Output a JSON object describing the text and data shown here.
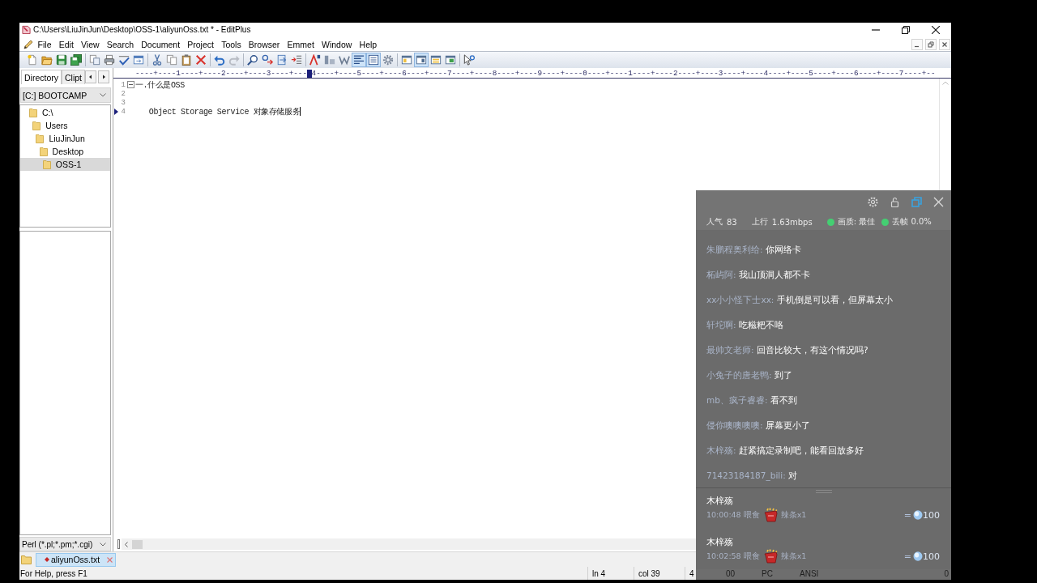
{
  "window": {
    "title": "C:\\Users\\LiuJinJun\\Desktop\\OSS-1\\aliyunOss.txt * - EditPlus"
  },
  "menu": [
    "File",
    "Edit",
    "View",
    "Search",
    "Document",
    "Project",
    "Tools",
    "Browser",
    "Emmet",
    "Window",
    "Help"
  ],
  "toolbar": [
    {
      "pressed": false
    },
    {
      "pressed": false
    },
    {
      "pressed": false
    },
    {
      "pressed": false
    },
    {
      "pressed": false
    },
    {
      "pressed": false
    },
    {
      "pressed": false
    },
    {
      "pressed": false
    },
    {
      "pressed": false
    },
    {
      "pressed": false
    },
    {
      "pressed": false
    },
    {
      "pressed": false
    },
    {
      "pressed": false
    },
    {
      "pressed": false
    },
    {
      "pressed": false
    },
    {
      "pressed": false
    },
    {
      "pressed": false
    },
    {
      "pressed": false
    },
    {
      "pressed": false
    },
    {
      "pressed": false
    },
    {
      "pressed": false
    },
    {
      "pressed": true
    },
    {
      "pressed": true
    },
    {
      "pressed": false
    },
    {
      "pressed": false
    },
    {
      "pressed": true
    },
    {
      "pressed": false
    },
    {
      "pressed": false
    },
    {
      "pressed": false
    }
  ],
  "sidebar": {
    "tabs": [
      {
        "label": "Directory",
        "selected": true
      },
      {
        "label": "Clipt",
        "selected": false
      }
    ],
    "drive": "[C:] BOOTCAMP",
    "tree": [
      {
        "label": "C:\\",
        "selected": false,
        "children": [
          {
            "label": "Users",
            "selected": false,
            "children": [
              {
                "label": "LiuJinJun",
                "selected": false,
                "children": [
                  {
                    "label": "Desktop",
                    "selected": false,
                    "children": [
                      {
                        "label": "OSS-1",
                        "selected": true
                      }
                    ]
                  }
                ]
              }
            ]
          }
        ]
      }
    ],
    "filter": "Perl (*.pl;*.pm;*.cgi)"
  },
  "editor": {
    "ruler_left": "----+----1----+----2----+----3----+---",
    "ruler_right": "4----+----5----+----6----+----7----+----8----+----9----+----0----+----1----+----2----+----3----+----4----+----5----+----6----+----7----+--",
    "lines": [
      {
        "number": "1",
        "text": "一.什么是OSS",
        "fold_marker": true,
        "current": false
      },
      {
        "number": "2",
        "fold_marker": false,
        "current": false
      },
      {
        "number": "3",
        "fold_marker": false,
        "current": false
      },
      {
        "number": "4",
        "text": "   Object Storage Service 对象存储服务",
        "fold_marker": false,
        "current": true
      }
    ]
  },
  "document_tabs": [
    {
      "label": "aliyunOss.txt",
      "selected": true,
      "modified": true
    }
  ],
  "status_bar": {
    "message": "For Help, press F1",
    "cells": [
      "ln 4",
      "col 39",
      "4",
      "00",
      "PC",
      "ANSI",
      "0"
    ]
  },
  "live_panel": {
    "stats": [
      {
        "kind": "counter",
        "label": "人气",
        "value": "83"
      },
      {
        "kind": "counter",
        "label": "上行",
        "value": "1.63mbps"
      },
      {
        "kind": "indicator",
        "text": "画质: 最佳",
        "color": "#44cf72"
      },
      {
        "kind": "indicator",
        "text": "丢帧 0.0%",
        "color": "#44cf72"
      }
    ],
    "messages": [
      {
        "user": "朱鹏程奥利给:",
        "text": "你网络卡"
      },
      {
        "user": "柘屿阿:",
        "text": "我山顶洞人都不卡"
      },
      {
        "user": "xx小小怪下士xx:",
        "text": "手机倒是可以看，但屏幕太小"
      },
      {
        "user": "轩坨啊:",
        "text": "吃糍粑不咯"
      },
      {
        "user": "最帅文老师:",
        "text": "回音比较大，有这个情况吗?"
      },
      {
        "user": "小兔子的唐老鸭:",
        "text": "到了"
      },
      {
        "user": "mb、疯子睿睿:",
        "text": "看不到"
      },
      {
        "user": "侵你噢噢噢噢:",
        "text": "屏幕更小了"
      },
      {
        "user": "木梓殇:",
        "text": "赶紧搞定录制吧，能看回放多好"
      },
      {
        "user": "71423184187_bili:",
        "text": "对"
      }
    ],
    "gifts": [
      {
        "sender": "木梓殇",
        "time": "10:00:48 喂食",
        "gift": "辣条x1",
        "equals": "=",
        "price": "100"
      },
      {
        "sender": "木梓殇",
        "time": "10:02:58 喂食",
        "gift": "辣条x1",
        "equals": "=",
        "price": "100"
      }
    ]
  }
}
